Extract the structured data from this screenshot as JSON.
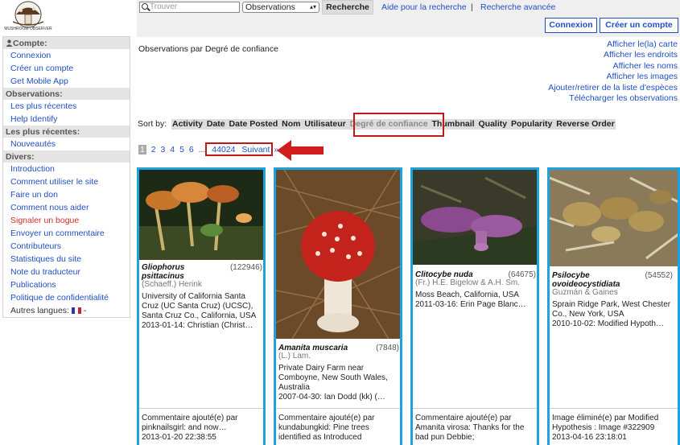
{
  "logo": {
    "text": "MUSHROOM OBSERVER"
  },
  "sidebar": {
    "sections": [
      {
        "title": "Compte:",
        "icon": "user-icon",
        "items": [
          {
            "label": "Connexion",
            "style": "link"
          },
          {
            "label": "Créer un compte",
            "style": "link"
          },
          {
            "label": "Get Mobile App",
            "style": "link"
          }
        ]
      },
      {
        "title": "Observations:",
        "items": [
          {
            "label": "Les plus récentes",
            "style": "link"
          },
          {
            "label": "Help Identify",
            "style": "link"
          }
        ]
      },
      {
        "title": "Les plus récentes:",
        "items": [
          {
            "label": "Nouveautés",
            "style": "link"
          }
        ]
      },
      {
        "title": "Divers:",
        "items": [
          {
            "label": "Introduction",
            "style": "link"
          },
          {
            "label": "Comment utiliser le site",
            "style": "link"
          },
          {
            "label": "Faire un don",
            "style": "link"
          },
          {
            "label": "Comment nous aider",
            "style": "link"
          },
          {
            "label": "Signaler un bogue",
            "style": "red"
          },
          {
            "label": "Envoyer un commentaire",
            "style": "link"
          },
          {
            "label": "Contributeurs",
            "style": "link"
          },
          {
            "label": "Statistiques du site",
            "style": "link"
          },
          {
            "label": "Note du traducteur",
            "style": "link"
          },
          {
            "label": "Publications",
            "style": "link"
          },
          {
            "label": "Politique de confidentialité",
            "style": "link"
          },
          {
            "label": "Autres langues:",
            "style": "plain",
            "suffix": " -"
          }
        ]
      }
    ]
  },
  "search": {
    "placeholder": "Trouver",
    "type_value": "Observations",
    "button_label": "Recherche",
    "help_link": "Aide pour la recherche",
    "separator": "|",
    "advanced_link": "Recherche avancée"
  },
  "auth": {
    "login_label": "Connexion",
    "signup_label": "Créer un compte"
  },
  "page_title": "Observations par Degré de confiance",
  "right_links": [
    "Afficher le(la) carte",
    "Afficher les endroits",
    "Afficher les noms",
    "Afficher les images",
    "Ajouter/retirer de la liste d'espèces",
    "Télécharger les observations"
  ],
  "sort": {
    "label": "Sort by:",
    "options": [
      "Activity",
      "Date",
      "Date Posted",
      "Nom",
      "Utilisateur",
      "Degré de confiance",
      "Thumbnail",
      "Quality",
      "Popularity",
      "Reverse Order"
    ],
    "active": "Degré de confiance"
  },
  "pagination": {
    "current": "1",
    "pages": [
      "2",
      "3",
      "4",
      "5",
      "6"
    ],
    "ellipsis": "...",
    "last": "44024",
    "next": "Suivant",
    "next_arrow": "»"
  },
  "colors": {
    "card_border": "#1ea3de",
    "highlight": "#c01818",
    "link": "#1f4fc2"
  },
  "cards": [
    {
      "name": "Gliophorus psittacinus",
      "id": "(122946)",
      "author": "(Schaeff.) Herink",
      "location": "University of California Santa Cruz (UC Santa Cruz) (UCSC), Santa Cruz Co., California, USA",
      "date_line": "2013-01-14: Christian (Christ…",
      "comment": "Commentaire ajouté(e) par pinknailsgirl: and now…",
      "timestamp": "2013-01-20 22:38:55"
    },
    {
      "name": "Amanita muscaria",
      "id": "(7848)",
      "author": "(L.) Lam.",
      "location": "Private Dairy Farm near Comboyne, New South Wales, Australia",
      "date_line": "2007-04-30: Ian Dodd (kk) (…",
      "comment": "Commentaire ajouté(e) par kundabungkid: Pine trees identified as Introduced",
      "timestamp": ""
    },
    {
      "name": "Clitocybe nuda",
      "id": "(64675)",
      "author": "(Fr.) H.E. Bigelow & A.H. Sm.",
      "location": "Moss Beach, California, USA",
      "date_line": "2011-03-16: Erin Page Blanc…",
      "comment": "Commentaire ajouté(e) par Amanita virosa: Thanks for the bad pun Debbie;",
      "timestamp": ""
    },
    {
      "name": "Psilocybe ovoideocystidiata",
      "id": "(54552)",
      "author": "Guzmán & Gaines",
      "location": "Sprain Ridge Park, West Chester Co., New York, USA",
      "date_line": "2010-10-02: Modified Hypoth…",
      "comment": "Image éliminé(e) par Modified Hypothesis : Image #322909",
      "timestamp": "2013-04-16 23:18:01"
    }
  ]
}
